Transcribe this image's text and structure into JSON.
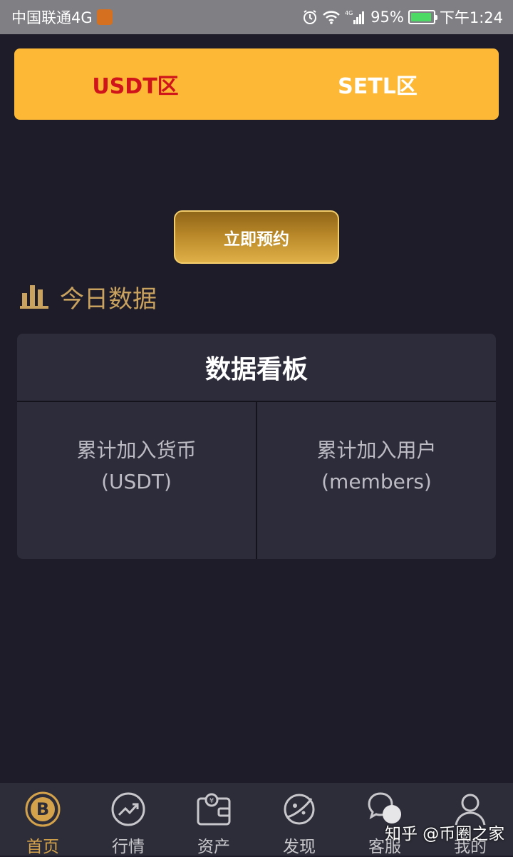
{
  "status_bar": {
    "carrier": "中国联通4G",
    "network_badge": "4G",
    "battery": "95%",
    "battery_level": 0.95,
    "time": "下午1:24",
    "icons": [
      "alarm-icon",
      "wifi-icon",
      "signal-icon",
      "battery-icon"
    ]
  },
  "zone_tabs": {
    "tabs": [
      {
        "label": "USDT区",
        "active": true
      },
      {
        "label": "SETL区",
        "active": false
      }
    ],
    "active_color": "#d0141b",
    "background": "#fdb936"
  },
  "reserve_button": {
    "label": "立即预约"
  },
  "today_section": {
    "title": "今日数据",
    "icon": "bar-chart-icon",
    "accent": "#c9a25f"
  },
  "dashboard": {
    "title": "数据看板",
    "cells": [
      {
        "line1": "累计加入货币",
        "line2": "(USDT)"
      },
      {
        "line1": "累计加入用户",
        "line2": "(members)"
      }
    ]
  },
  "bottom_nav": {
    "items": [
      {
        "label": "首页",
        "icon": "bitcoin-icon",
        "active": true
      },
      {
        "label": "行情",
        "icon": "trend-icon",
        "active": false
      },
      {
        "label": "资产",
        "icon": "wallet-icon",
        "active": false
      },
      {
        "label": "发现",
        "icon": "planet-icon",
        "active": false
      },
      {
        "label": "客服",
        "icon": "chat-icon",
        "active": false
      },
      {
        "label": "我的",
        "icon": "user-icon",
        "active": false
      }
    ],
    "active_color": "#d4a24a"
  },
  "watermark": "知乎 @币圈之家"
}
